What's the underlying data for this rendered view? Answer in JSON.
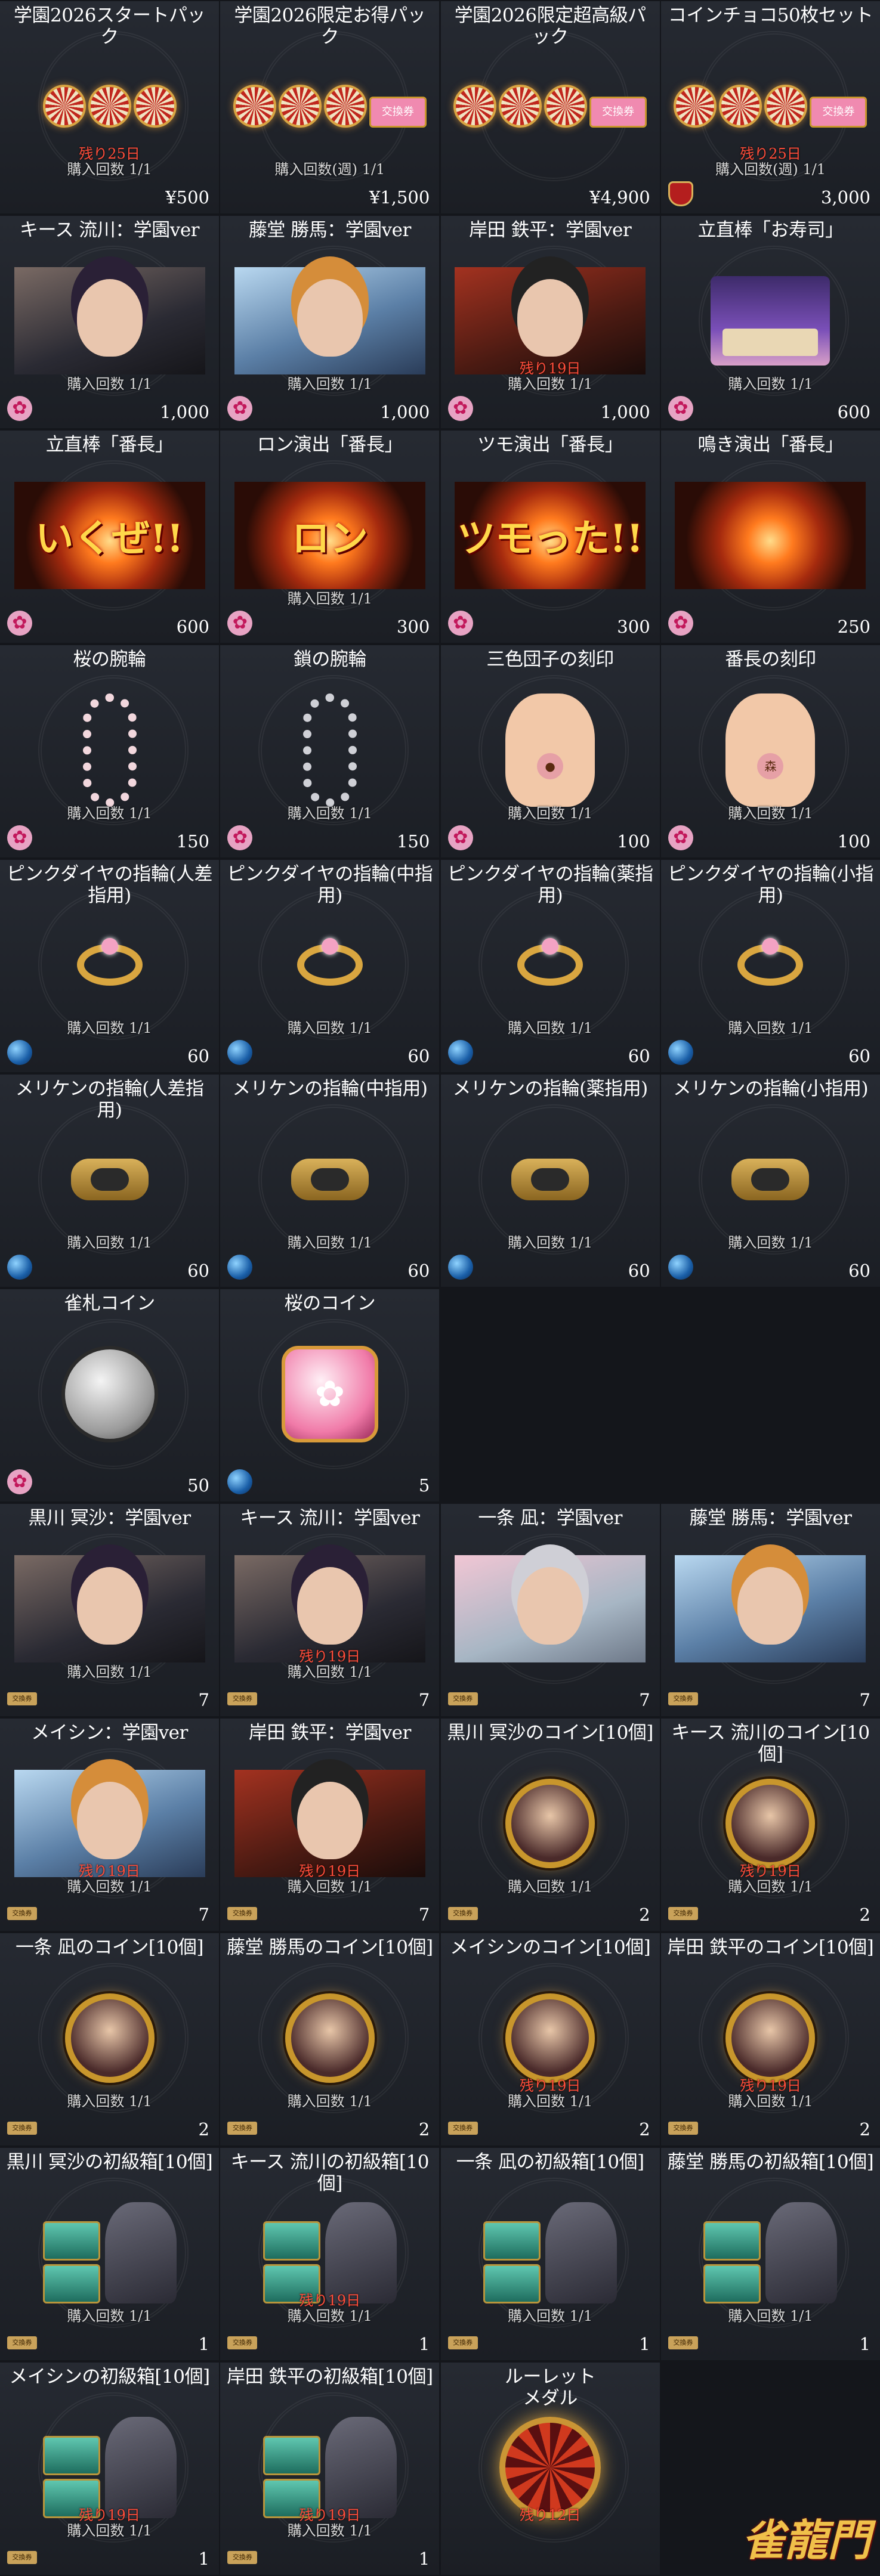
{
  "items": [
    {
      "title": "学園2026スタートパック",
      "art": "pack",
      "remain": "残り25日",
      "limit": "購入回数 1/1",
      "currency": "",
      "price": "¥500"
    },
    {
      "title": "学園2026限定お得パック",
      "art": "pack-ticket",
      "remain": "",
      "limit": "購入回数(週) 1/1",
      "currency": "",
      "price": "¥1,500"
    },
    {
      "title": "学園2026限定超高級パック",
      "art": "pack-ticket",
      "remain": "",
      "limit": "",
      "currency": "",
      "price": "¥4,900"
    },
    {
      "title": "コインチョコ50枚セット",
      "art": "pack-ticket",
      "remain": "残り25日",
      "limit": "購入回数(週) 1/1",
      "currency": "shield",
      "price": "3,000"
    },
    {
      "title": "キース 流川：学園ver",
      "art": "portrait",
      "variant": "",
      "remain": "",
      "limit": "購入回数 1/1",
      "currency": "sakura",
      "price": "1,000"
    },
    {
      "title": "藤堂 勝馬：学園ver",
      "art": "portrait",
      "variant": "bright",
      "remain": "",
      "limit": "購入回数 1/1",
      "currency": "sakura",
      "price": "1,000"
    },
    {
      "title": "岸田 鉄平：学園ver",
      "art": "portrait",
      "variant": "red",
      "remain": "残り19日",
      "limit": "購入回数 1/1",
      "currency": "sakura",
      "price": "1,000"
    },
    {
      "title": "立直棒「お寿司」",
      "art": "sushi",
      "remain": "",
      "limit": "購入回数 1/1",
      "currency": "sakura",
      "price": "600"
    },
    {
      "title": "立直棒「番長」",
      "art": "fx",
      "fxtext": "いくぜ!!",
      "remain": "",
      "limit": "",
      "currency": "sakura",
      "price": "600"
    },
    {
      "title": "ロン演出「番長」",
      "art": "fx",
      "fxtext": "ロン",
      "remain": "",
      "limit": "購入回数 1/1",
      "currency": "sakura",
      "price": "300"
    },
    {
      "title": "ツモ演出「番長」",
      "art": "fx",
      "fxtext": "ツモった!!",
      "remain": "",
      "limit": "",
      "currency": "sakura",
      "price": "300"
    },
    {
      "title": "鳴き演出「番長」",
      "art": "fx-small",
      "fxtext": "",
      "remain": "",
      "limit": "",
      "currency": "sakura",
      "price": "250"
    },
    {
      "title": "桜の腕輪",
      "art": "bracelet-sakura",
      "remain": "",
      "limit": "購入回数 1/1",
      "currency": "sakura",
      "price": "150"
    },
    {
      "title": "鎖の腕輪",
      "art": "bracelet",
      "remain": "",
      "limit": "購入回数 1/1",
      "currency": "sakura",
      "price": "150"
    },
    {
      "title": "三色団子の刻印",
      "art": "hand",
      "mark": "●",
      "remain": "",
      "limit": "購入回数 1/1",
      "currency": "sakura",
      "price": "100"
    },
    {
      "title": "番長の刻印",
      "art": "hand",
      "mark": "森",
      "remain": "",
      "limit": "購入回数 1/1",
      "currency": "sakura",
      "price": "100"
    },
    {
      "title": "ピンクダイヤの指輪(人差指用)",
      "art": "ring",
      "remain": "",
      "limit": "購入回数 1/1",
      "currency": "blue",
      "price": "60"
    },
    {
      "title": "ピンクダイヤの指輪(中指用)",
      "art": "ring",
      "remain": "",
      "limit": "購入回数 1/1",
      "currency": "blue",
      "price": "60"
    },
    {
      "title": "ピンクダイヤの指輪(薬指用)",
      "art": "ring",
      "remain": "",
      "limit": "購入回数 1/1",
      "currency": "blue",
      "price": "60"
    },
    {
      "title": "ピンクダイヤの指輪(小指用)",
      "art": "ring",
      "remain": "",
      "limit": "購入回数 1/1",
      "currency": "blue",
      "price": "60"
    },
    {
      "title": "メリケンの指輪(人差指用)",
      "art": "knuckle",
      "remain": "",
      "limit": "購入回数 1/1",
      "currency": "blue",
      "price": "60"
    },
    {
      "title": "メリケンの指輪(中指用)",
      "art": "knuckle",
      "remain": "",
      "limit": "購入回数 1/1",
      "currency": "blue",
      "price": "60"
    },
    {
      "title": "メリケンの指輪(薬指用)",
      "art": "knuckle",
      "remain": "",
      "limit": "購入回数 1/1",
      "currency": "blue",
      "price": "60"
    },
    {
      "title": "メリケンの指輪(小指用)",
      "art": "knuckle",
      "remain": "",
      "limit": "購入回数 1/1",
      "currency": "blue",
      "price": "60"
    },
    {
      "title": "雀札コイン",
      "art": "coin",
      "remain": "",
      "limit": "",
      "currency": "sakura",
      "price": "50"
    },
    {
      "title": "桜のコイン",
      "art": "coin-pink",
      "remain": "",
      "limit": "",
      "currency": "blue",
      "price": "5"
    },
    {
      "empty": true
    },
    {
      "empty": true
    },
    {
      "title": "黒川 冥沙：学園ver",
      "art": "portrait",
      "variant": "",
      "remain": "",
      "limit": "購入回数 1/1",
      "currency": "ticket",
      "price": "7"
    },
    {
      "title": "キース 流川：学園ver",
      "art": "portrait",
      "variant": "",
      "remain": "残り19日",
      "limit": "購入回数 1/1",
      "currency": "ticket",
      "price": "7"
    },
    {
      "title": "一条 凪：学園ver",
      "art": "portrait",
      "variant": "pink",
      "remain": "",
      "limit": "",
      "currency": "ticket",
      "price": "7"
    },
    {
      "title": "藤堂 勝馬：学園ver",
      "art": "portrait",
      "variant": "bright",
      "remain": "",
      "limit": "",
      "currency": "ticket",
      "price": "7"
    },
    {
      "title": "メイシン：学園ver",
      "art": "portrait",
      "variant": "bright",
      "remain": "残り19日",
      "limit": "購入回数 1/1",
      "currency": "ticket",
      "price": "7"
    },
    {
      "title": "岸田 鉄平：学園ver",
      "art": "portrait",
      "variant": "red",
      "remain": "残り19日",
      "limit": "購入回数 1/1",
      "currency": "ticket",
      "price": "7"
    },
    {
      "title": "黒川 冥沙のコイン[10個]",
      "art": "medal",
      "remain": "",
      "limit": "購入回数 1/1",
      "currency": "ticket",
      "price": "2"
    },
    {
      "title": "キース 流川のコイン[10個]",
      "art": "medal",
      "remain": "残り19日",
      "limit": "購入回数 1/1",
      "currency": "ticket",
      "price": "2"
    },
    {
      "title": "一条 凪のコイン[10個]",
      "art": "medal",
      "remain": "",
      "limit": "購入回数 1/1",
      "currency": "ticket",
      "price": "2"
    },
    {
      "title": "藤堂 勝馬のコイン[10個]",
      "art": "medal",
      "remain": "",
      "limit": "購入回数 1/1",
      "currency": "ticket",
      "price": "2"
    },
    {
      "title": "メイシンのコイン[10個]",
      "art": "medal",
      "remain": "残り19日",
      "limit": "購入回数 1/1",
      "currency": "ticket",
      "price": "2"
    },
    {
      "title": "岸田 鉄平のコイン[10個]",
      "art": "medal",
      "remain": "残り19日",
      "limit": "購入回数 1/1",
      "currency": "ticket",
      "price": "2"
    },
    {
      "title": "黒川 冥沙の初級箱[10個]",
      "art": "chest",
      "remain": "",
      "limit": "購入回数 1/1",
      "currency": "ticket",
      "price": "1"
    },
    {
      "title": "キース 流川の初級箱[10個]",
      "art": "chest",
      "remain": "残り19日",
      "limit": "購入回数 1/1",
      "currency": "ticket",
      "price": "1"
    },
    {
      "title": "一条 凪の初級箱[10個]",
      "art": "chest",
      "remain": "",
      "limit": "購入回数 1/1",
      "currency": "ticket",
      "price": "1"
    },
    {
      "title": "藤堂 勝馬の初級箱[10個]",
      "art": "chest",
      "remain": "",
      "limit": "購入回数 1/1",
      "currency": "ticket",
      "price": "1"
    },
    {
      "title": "メイシンの初級箱[10個]",
      "art": "chest",
      "remain": "残り19日",
      "limit": "購入回数 1/1",
      "currency": "ticket",
      "price": "1"
    },
    {
      "title": "岸田 鉄平の初級箱[10個]",
      "art": "chest",
      "remain": "残り19日",
      "limit": "購入回数 1/1",
      "currency": "ticket",
      "price": "1"
    },
    {
      "title": "ルーレット\nメダル",
      "art": "roulette",
      "remain": "残り12日",
      "limit": "",
      "currency": "",
      "price": ""
    },
    {
      "empty": true,
      "logo": true
    }
  ],
  "ticket_label": "交換券",
  "logo_text": "雀龍門"
}
